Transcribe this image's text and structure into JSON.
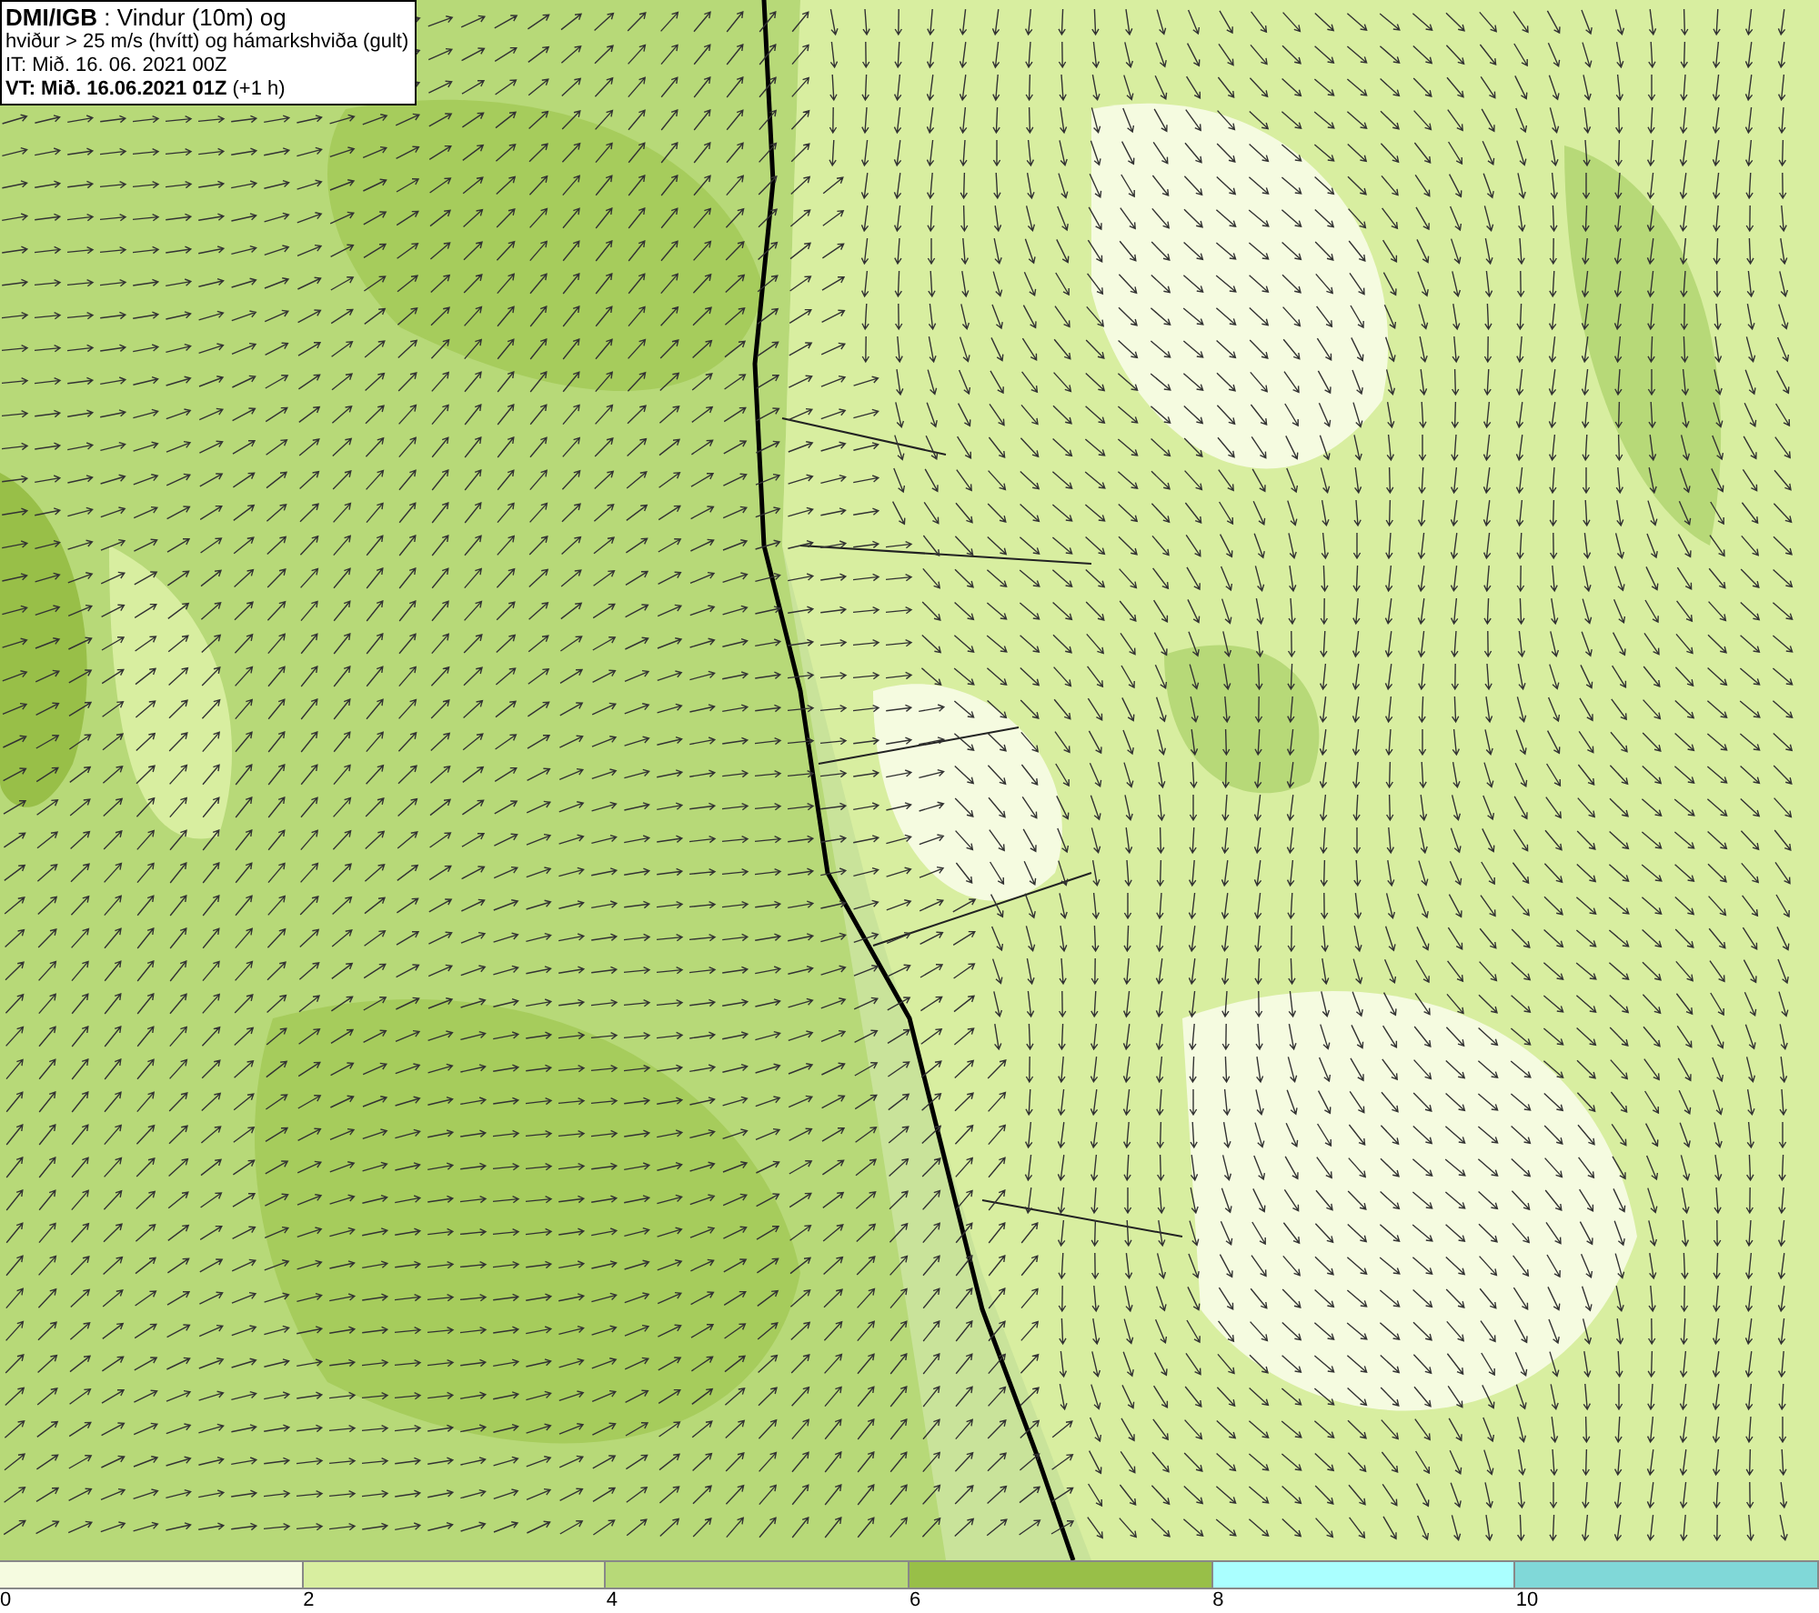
{
  "header": {
    "lines": [
      "**DMI/IGB** : Vindur (10m) og",
      "hviður > 25 m/s (hvítt) og hámarkshviða (gult)",
      "IT: Mið. 16. 06. 2021 00Z",
      "**VT: Mið. 16.06.2021 01Z** (+1 h)"
    ]
  },
  "legend": {
    "segments": [
      {
        "color": "#f5fbe0"
      },
      {
        "color": "#d8eea0"
      },
      {
        "color": "#b7d978"
      },
      {
        "color": "#98bf48"
      },
      {
        "color": "#aaffff"
      },
      {
        "color": "#80d8d8"
      }
    ],
    "ticks": [
      "0",
      "2",
      "4",
      "6",
      "8",
      "10"
    ]
  }
}
